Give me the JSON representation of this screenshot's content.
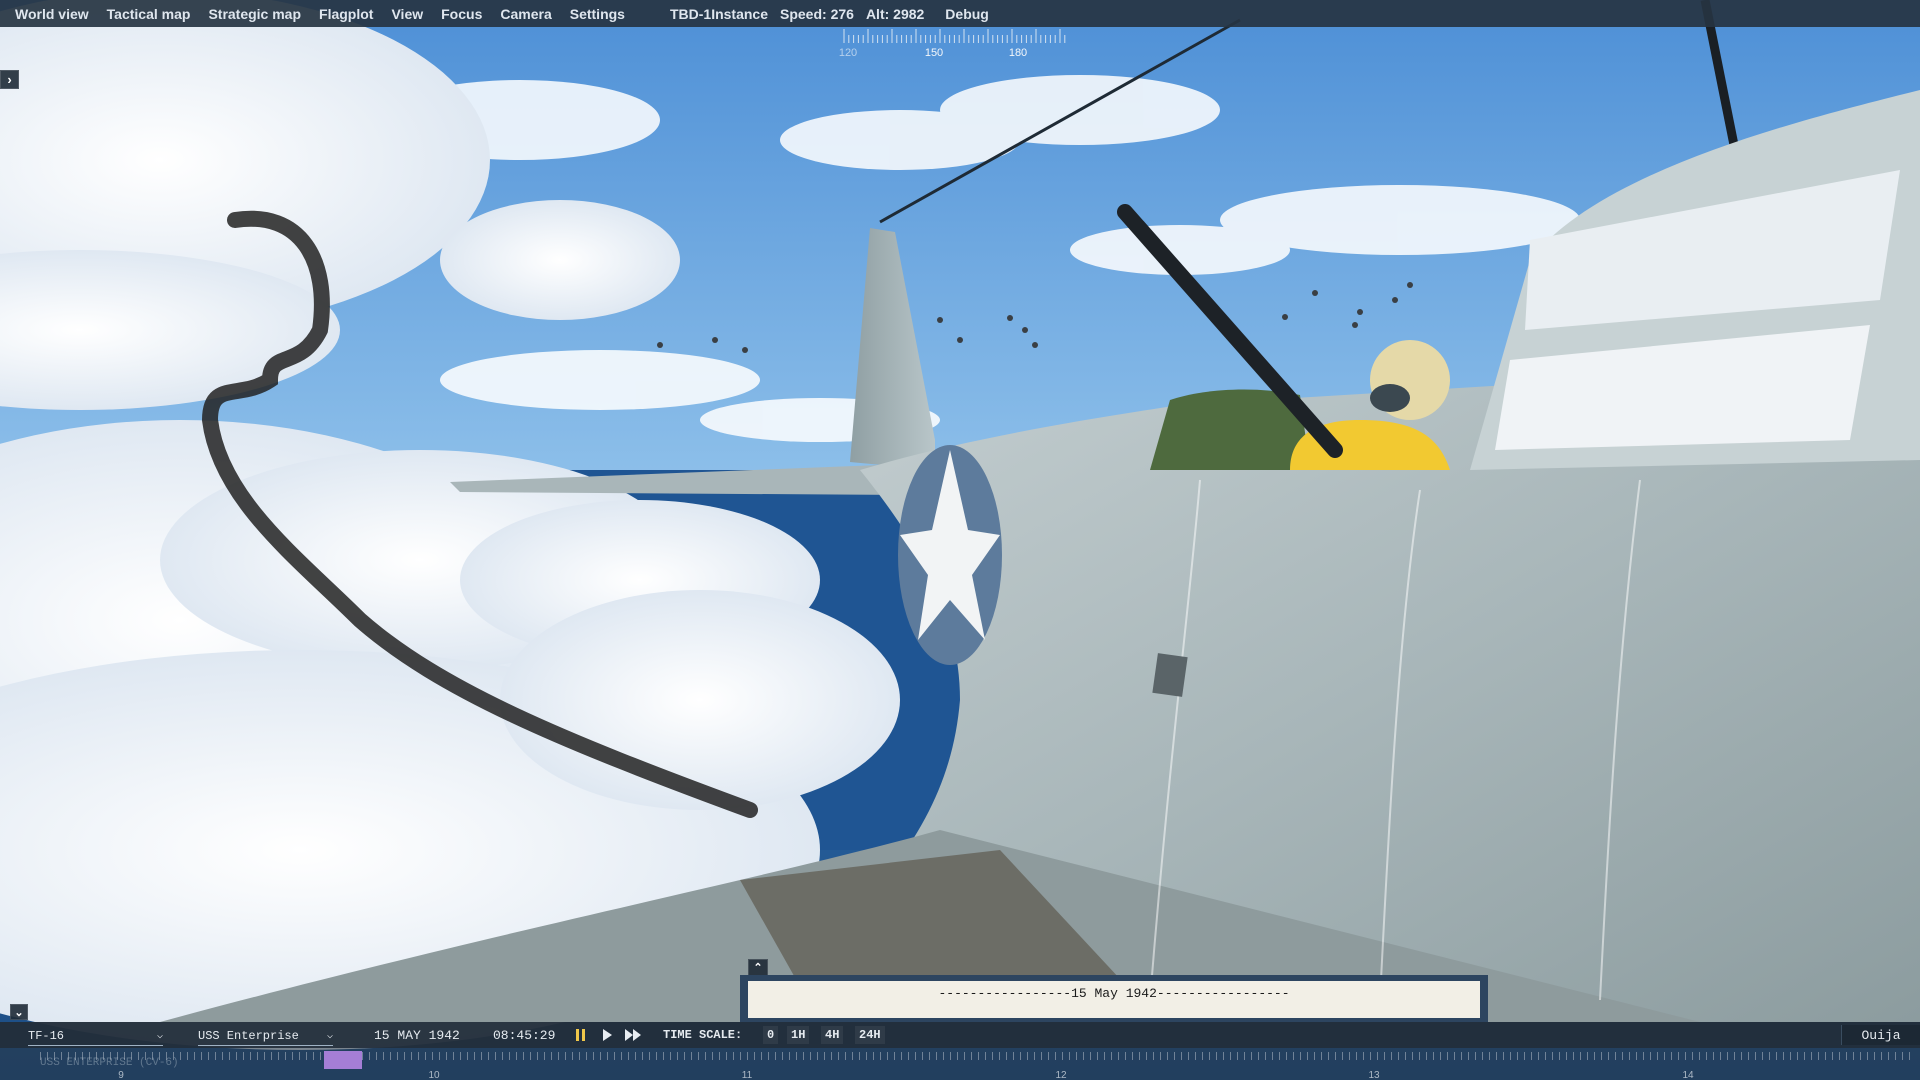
{
  "menu": {
    "items": [
      "World view",
      "Tactical map",
      "Strategic map",
      "Flagplot",
      "View",
      "Focus",
      "Camera",
      "Settings"
    ],
    "debug": "Debug"
  },
  "status": {
    "unit": "TBD-1Instance",
    "speed": "Speed: 276",
    "alt": "Alt: 2982"
  },
  "compass": {
    "labels": [
      "120",
      "150",
      "180"
    ]
  },
  "log": {
    "line": "-----------------15 May 1942-----------------"
  },
  "bottombar": {
    "task_force": "TF-16",
    "ship": "USS Enterprise",
    "date": "15 MAY 1942",
    "time": "08:45:29",
    "time_scale_label": "TIME SCALE:",
    "time_scales": [
      "0",
      "1H",
      "4H",
      "24H"
    ],
    "ouija": "Ouija"
  },
  "timeline": {
    "row_label": "USS ENTERPRISE (CV-6)",
    "hours": [
      "9",
      "10",
      "11",
      "12",
      "13",
      "14"
    ]
  },
  "colors": {
    "sky": "#5f9fd8",
    "panel": "#263442",
    "timeline_marker": "#a57ed6"
  },
  "icons": {
    "pause": "pause-icon",
    "play": "play-icon",
    "fast_forward": "fast-forward-icon"
  }
}
